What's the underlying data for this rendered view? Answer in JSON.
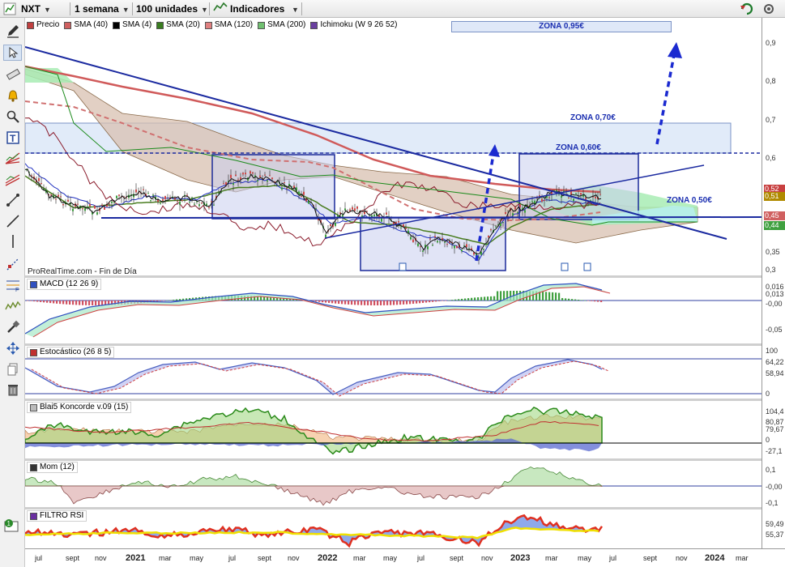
{
  "toolbar": {
    "ticker": "NXT",
    "period": "1 semana",
    "units": "100 unidades",
    "indicators": "Indicadores"
  },
  "legend": [
    {
      "label": "Precio",
      "color": "#c04040"
    },
    {
      "label": "SMA (40)",
      "color": "#d06060"
    },
    {
      "label": "SMA (4)",
      "color": "#000000"
    },
    {
      "label": "SMA (20)",
      "color": "#3a7d20"
    },
    {
      "label": "SMA (120)",
      "color": "#e08080"
    },
    {
      "label": "SMA (200)",
      "color": "#70c070"
    },
    {
      "label": "Ichimoku (W 9 26 52)",
      "color": "#6a3fa0"
    }
  ],
  "zones": {
    "z095": "ZONA 0,95€",
    "z070": "ZONA 0,70€",
    "z060": "ZONA 0,60€",
    "z050": "ZONA 0,50€"
  },
  "source": "ProRealTime.com - Fin de Día",
  "panels": {
    "macd": "MACD (12 26 9)",
    "stoch": "Estocástico (26 8 5)",
    "koncorde": "Blai5 Koncorde v.09 (15)",
    "mom": "Mom (12)",
    "rsi": "FILTRO RSI"
  },
  "price_axis": {
    "ticks": [
      "0,9",
      "0,8",
      "0,7",
      "0,6",
      "0,35",
      "0,3"
    ],
    "badges": [
      {
        "text": "0,52",
        "color": "#c84040"
      },
      {
        "text": "0,51",
        "color": "#b08a00"
      },
      {
        "text": "0,45",
        "color": "#d06060"
      },
      {
        "text": "0,44",
        "color": "#40a040"
      }
    ]
  },
  "macd_axis": {
    "ticks": [
      "0,016",
      "0,013",
      "-0,00",
      "-0,05"
    ]
  },
  "stoch_axis": {
    "ticks": [
      "100",
      "64,22",
      "58,94",
      "0"
    ]
  },
  "koncorde_axis": {
    "ticks": [
      "104,4",
      "80,87",
      "79,67",
      "0",
      "-27,1"
    ]
  },
  "mom_axis": {
    "ticks": [
      "0,1",
      "-0,00",
      "-0,1"
    ]
  },
  "rsi_axis": {
    "ticks": [
      "59,49",
      "55,37"
    ]
  },
  "xaxis": [
    {
      "label": "jul",
      "year": false
    },
    {
      "label": "sept",
      "year": false
    },
    {
      "label": "nov",
      "year": false
    },
    {
      "label": "2021",
      "year": true
    },
    {
      "label": "mar",
      "year": false
    },
    {
      "label": "may",
      "year": false
    },
    {
      "label": "jul",
      "year": false
    },
    {
      "label": "sept",
      "year": false
    },
    {
      "label": "nov",
      "year": false
    },
    {
      "label": "2022",
      "year": true
    },
    {
      "label": "mar",
      "year": false
    },
    {
      "label": "may",
      "year": false
    },
    {
      "label": "jul",
      "year": false
    },
    {
      "label": "sept",
      "year": false
    },
    {
      "label": "nov",
      "year": false
    },
    {
      "label": "2023",
      "year": true
    },
    {
      "label": "mar",
      "year": false
    },
    {
      "label": "may",
      "year": false
    },
    {
      "label": "jul",
      "year": false
    },
    {
      "label": "sept",
      "year": false
    },
    {
      "label": "nov",
      "year": false
    },
    {
      "label": "2024",
      "year": true
    },
    {
      "label": "mar",
      "year": false
    }
  ]
}
